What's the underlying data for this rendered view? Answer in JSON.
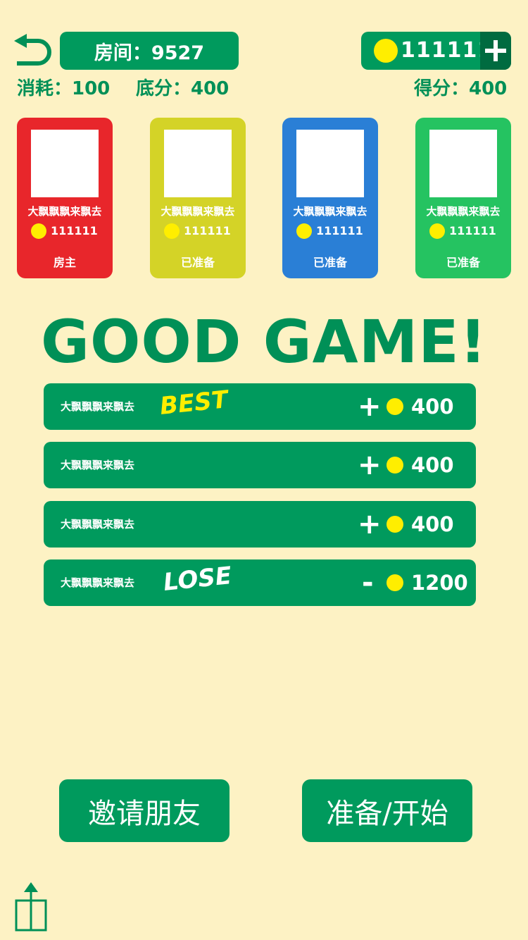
{
  "header": {
    "room_label": "房间：9527",
    "coins": "111111",
    "consume": "消耗：100",
    "base_score": "底分：400",
    "score": "得分：400"
  },
  "players": [
    {
      "name": "大飘飘飘来飘去",
      "coins": "111111",
      "status": "房主",
      "color": "#e8262b"
    },
    {
      "name": "大飘飘飘来飘去",
      "coins": "111111",
      "status": "已准备",
      "color": "#d4d327"
    },
    {
      "name": "大飘飘飘来飘去",
      "coins": "111111",
      "status": "已准备",
      "color": "#2a7fd6"
    },
    {
      "name": "大飘飘飘来飘去",
      "coins": "111111",
      "status": "已准备",
      "color": "#25c361"
    }
  ],
  "result": {
    "title": "GOOD GAME!",
    "rows": [
      {
        "name": "大飘飘飘来飘去",
        "tag": "BEST",
        "sign": "+",
        "amount": "400"
      },
      {
        "name": "大飘飘飘来飘去",
        "tag": "",
        "sign": "+",
        "amount": "400"
      },
      {
        "name": "大飘飘飘来飘去",
        "tag": "",
        "sign": "+",
        "amount": "400"
      },
      {
        "name": "大飘飘飘来飘去",
        "tag": "LOSE",
        "sign": "-",
        "amount": "1200"
      }
    ]
  },
  "actions": {
    "invite_label": "邀请朋友",
    "ready_label": "准备/开始"
  },
  "colors": {
    "background": "#fdf2c4",
    "primary_green": "#009a5d",
    "coin_yellow": "#ffee00"
  },
  "icons": {
    "back": "back-arrow-icon",
    "add": "plus-icon",
    "share": "share-icon",
    "coin": "coin-icon"
  }
}
